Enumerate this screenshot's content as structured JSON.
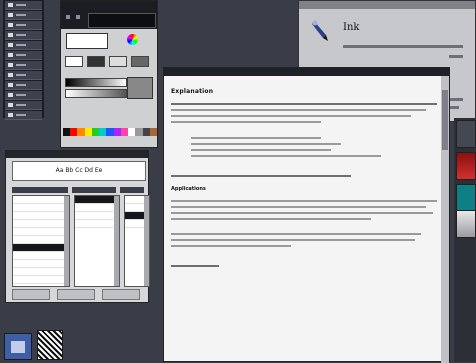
{
  "about": {
    "app_name": "Ink",
    "logo_icon": "ink-pen-icon"
  },
  "help": {
    "section_heading": "Explanation",
    "subheading": "Applications"
  },
  "font_dialog": {
    "sample": "Aa Bb Cc Dd Ee"
  },
  "colors": {
    "desktop": "#3a3d48",
    "titlebar": "#1e2027",
    "palette": [
      "#111111",
      "#ff0000",
      "#ff8800",
      "#ffee00",
      "#22cc22",
      "#00cccc",
      "#2255ff",
      "#aa22ff",
      "#ff44aa",
      "#ffffff",
      "#999999",
      "#444444",
      "#aa6633"
    ]
  },
  "icons": {
    "dock": [
      "window-manager-icon",
      "pattern-icon"
    ],
    "right_edge": [
      "tool-icon",
      "red-object-icon",
      "ni-logo-icon",
      "person-icon"
    ]
  }
}
